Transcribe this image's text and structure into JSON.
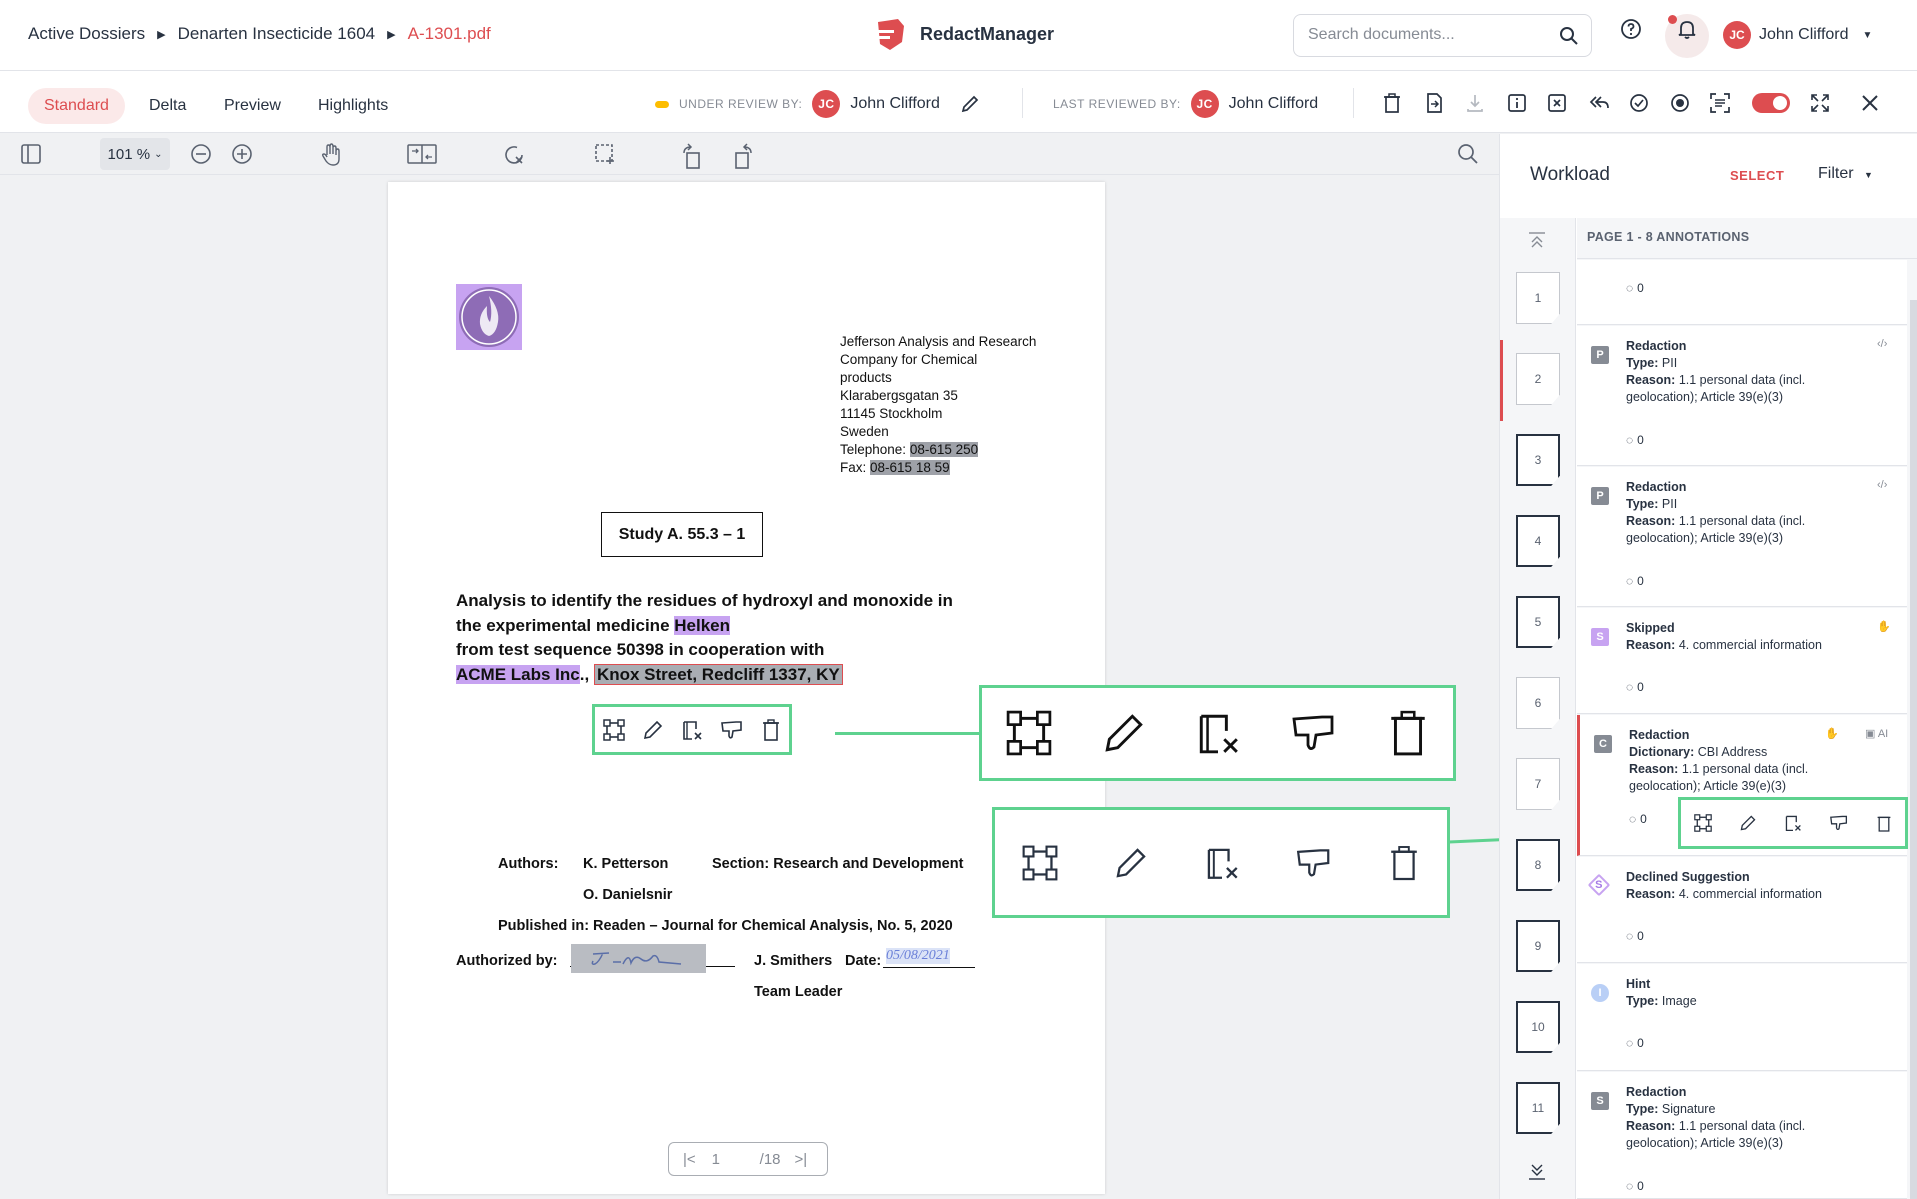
{
  "breadcrumb": {
    "item1": "Active Dossiers",
    "item2": "Denarten Insecticide 1604",
    "file": "A-1301.pdf"
  },
  "brand": {
    "name": "RedactManager",
    "accent": "#dd4d50"
  },
  "search": {
    "placeholder": "Search documents..."
  },
  "user": {
    "initials": "JC",
    "name": "John Clifford"
  },
  "tabs": [
    "Standard",
    "Delta",
    "Preview",
    "Highlights"
  ],
  "review": {
    "under_label": "UNDER REVIEW BY:",
    "under_name": "John Clifford",
    "last_label": "LAST REVIEWED BY:",
    "last_name": "John Clifford"
  },
  "viewer": {
    "zoom": "101 %"
  },
  "document": {
    "address": [
      "Jefferson Analysis and Research",
      "Company for Chemical",
      "products",
      "Klarabergsgatan 35",
      "11145 Stockholm",
      "Sweden"
    ],
    "tel_label": "Telephone:",
    "tel": "08-615 250",
    "fax_label": "Fax:",
    "fax": "08-615 18 59",
    "study": "Study A. 55.3 – 1",
    "title_line1": "Analysis to identify the residues of hydroxyl and monoxide in",
    "title_line2": "the experimental medicine",
    "title_hl": "Helken",
    "title_line3": "from test sequence 50398 in cooperation with",
    "title_org": "ACME Labs Inc",
    "title_sep": ".,",
    "title_addr": "Knox Street, Redcliff 1337, KY",
    "authors_label": "Authors:",
    "author1": "K. Petterson",
    "author2": "O. Danielsnir",
    "section": "Section: Research and Development",
    "published": "Published in: Readen – Journal for Chemical Analysis, No. 5, 2020",
    "authorized_label": "Authorized by:",
    "signer": "J. Smithers",
    "date_label": "Date:",
    "date": "05/08/2021",
    "role": "Team Leader"
  },
  "pager": {
    "current": "1",
    "total": "/18"
  },
  "panel": {
    "title": "Workload",
    "select": "SELECT",
    "filter": "Filter",
    "page_title": "PAGE 1 - 8 ANNOTATIONS",
    "thumbs": [
      "1",
      "2",
      "3",
      "4",
      "5",
      "6",
      "7",
      "8",
      "9",
      "10",
      "11"
    ],
    "annotations": [
      {
        "count": "0"
      },
      {
        "badge": "P",
        "title": "Redaction",
        "l1k": "Type:",
        "l1v": "PII",
        "l2k": "Reason:",
        "l2v": "1.1 personal data (incl. geolocation); Article 39(e)(3)",
        "count": "0"
      },
      {
        "badge": "P",
        "title": "Redaction",
        "l1k": "Type:",
        "l1v": "PII",
        "l2k": "Reason:",
        "l2v": "1.1 personal data (incl. geolocation); Article 39(e)(3)",
        "count": "0"
      },
      {
        "badge": "S",
        "title": "Skipped",
        "l1k": "Reason:",
        "l1v": "4. commercial information",
        "count": "0"
      },
      {
        "badge": "C",
        "title": "Redaction",
        "l1k": "Dictionary:",
        "l1v": "CBI Address",
        "l2k": "Reason:",
        "l2v": "1.1 personal data (incl. geolocation); Article 39(e)(3)",
        "count": "0",
        "ai": "AI"
      },
      {
        "badge": "S",
        "title": "Declined Suggestion",
        "l1k": "Reason:",
        "l1v": "4. commercial information",
        "count": "0"
      },
      {
        "badge": "I",
        "title": "Hint",
        "l1k": "Type:",
        "l1v": "Image",
        "count": "0"
      },
      {
        "badge": "S",
        "title": "Redaction",
        "l1k": "Type:",
        "l1v": "Signature",
        "l2k": "Reason:",
        "l2v": "1.1 personal data (incl. geolocation); Article 39(e)(3)",
        "count": "0"
      }
    ]
  }
}
